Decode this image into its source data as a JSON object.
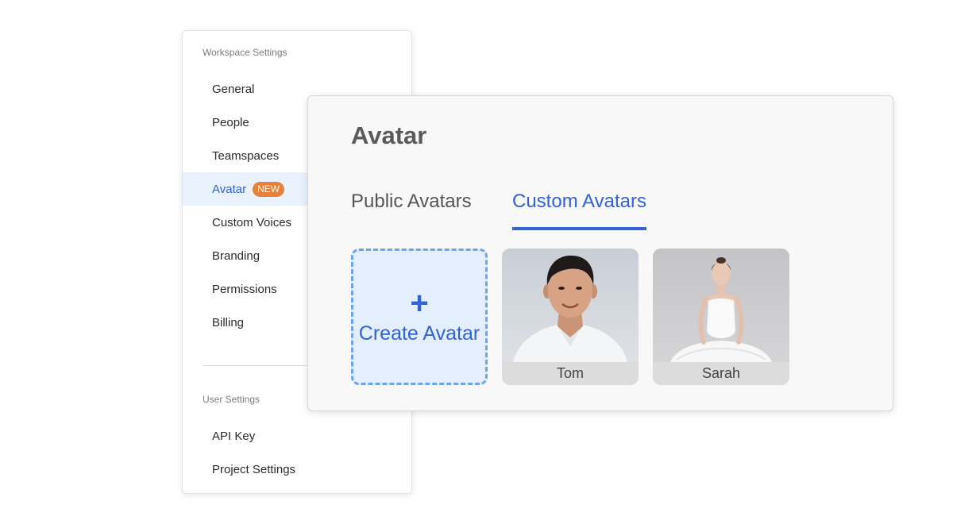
{
  "sidebar": {
    "workspace_title": "Workspace Settings",
    "workspace_items": [
      {
        "label": "General"
      },
      {
        "label": "People"
      },
      {
        "label": "Teamspaces"
      },
      {
        "label": "Avatar",
        "badge": "NEW",
        "active": true
      },
      {
        "label": "Custom Voices"
      },
      {
        "label": "Branding"
      },
      {
        "label": "Permissions"
      },
      {
        "label": "Billing"
      }
    ],
    "user_title": "User Settings",
    "user_items": [
      {
        "label": "API Key"
      },
      {
        "label": "Project Settings"
      }
    ]
  },
  "panel": {
    "title": "Avatar",
    "tabs": [
      {
        "label": "Public Avatars",
        "active": false
      },
      {
        "label": "Custom Avatars",
        "active": true
      }
    ],
    "create_card": {
      "icon": "plus-icon",
      "label": "Create Avatar"
    },
    "avatars": [
      {
        "name": "Tom"
      },
      {
        "name": "Sarah"
      }
    ]
  },
  "colors": {
    "accent": "#3361d8",
    "active_bg": "#e9f2fd",
    "badge": "#e8803a",
    "create_bg": "#e4effd",
    "create_border": "#6ea3ef"
  }
}
